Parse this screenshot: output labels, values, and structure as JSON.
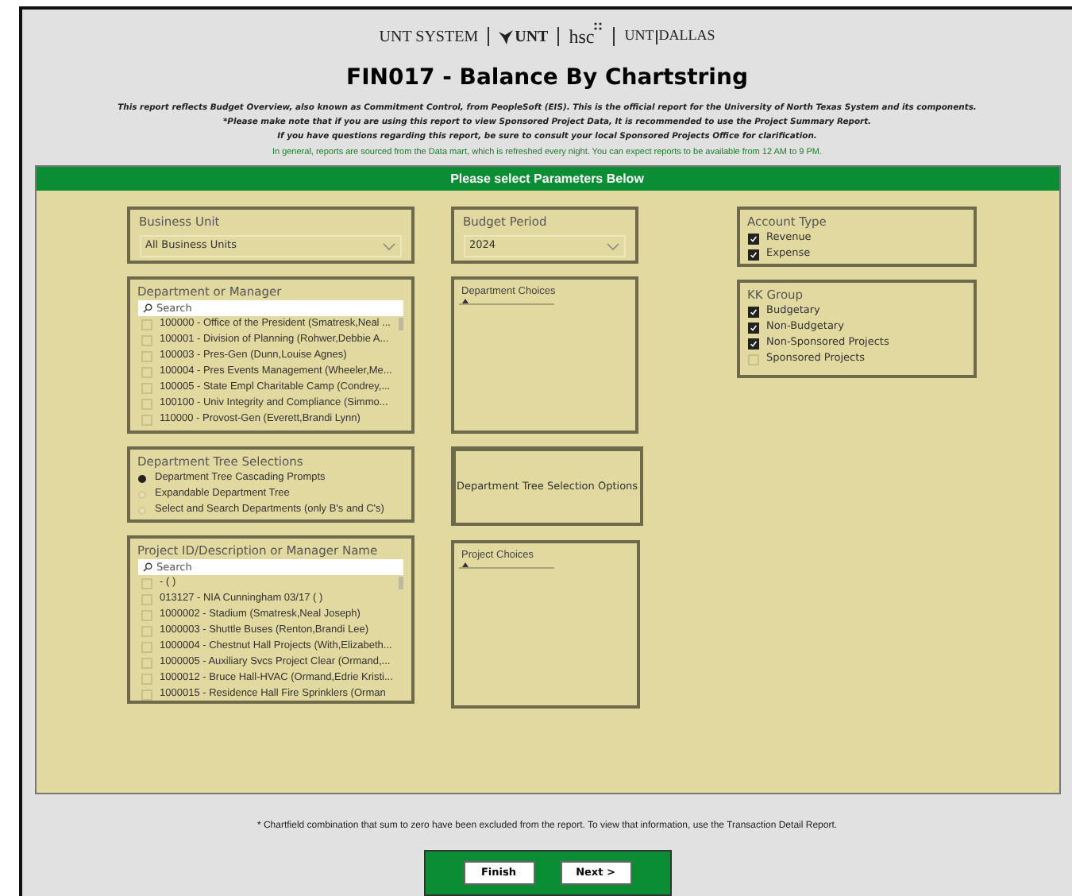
{
  "logos": [
    "UNT SYSTEM",
    "UNT",
    "hsc",
    "UNT",
    "DALLAS"
  ],
  "title": "FIN017 - Balance By Chartstring",
  "notes": [
    "This report reflects Budget Overview, also known as Commitment Control, from PeopleSoft (EIS). This is the official report for the University of North Texas System and its components.",
    "*Please make note that if you are using this report to view Sponsored Project Data, It is recommended to use the Project Summary Report.",
    "If you have questions regarding this report, be sure to consult your local Sponsored Projects Office for clarification."
  ],
  "info": "In general, reports are sourced from the Data mart, which is refreshed every night. You can expect reports to be available from 12 AM to 9 PM.",
  "panel_header": "Please select Parameters Below",
  "business_unit": {
    "label": "Business Unit",
    "value": "All Business Units"
  },
  "budget_period": {
    "label": "Budget Period",
    "value": "2024"
  },
  "account_type": {
    "label": "Account Type",
    "options": [
      {
        "label": "Revenue",
        "checked": true
      },
      {
        "label": "Expense",
        "checked": true
      }
    ]
  },
  "kk_group": {
    "label": "KK Group",
    "options": [
      {
        "label": "Budgetary",
        "checked": true
      },
      {
        "label": "Non-Budgetary",
        "checked": true
      },
      {
        "label": "Non-Sponsored Projects",
        "checked": true
      },
      {
        "label": "Sponsored Projects",
        "checked": false
      }
    ]
  },
  "department": {
    "label": "Department or Manager",
    "placeholder": "Search",
    "items": [
      {
        "label": "100000 - Office of the President (Smatresk,Neal ...",
        "checked": false
      },
      {
        "label": "100001 - Division of Planning (Rohwer,Debbie A...",
        "checked": false
      },
      {
        "label": "100003 - Pres-Gen (Dunn,Louise Agnes)",
        "checked": false
      },
      {
        "label": "100004 - Pres Events Management (Wheeler,Me...",
        "checked": false
      },
      {
        "label": "100005 - State Empl Charitable Camp (Condrey,...",
        "checked": false
      },
      {
        "label": "100100 - Univ Integrity and Compliance (Simmo...",
        "checked": false
      },
      {
        "label": "110000 - Provost-Gen (Everett,Brandi Lynn)",
        "checked": false
      }
    ]
  },
  "department_choices": {
    "label": "Department Choices"
  },
  "tree_selections": {
    "label": "Department Tree Selections",
    "options": [
      {
        "label": "Department Tree Cascading Prompts",
        "selected": true
      },
      {
        "label": "Expandable Department Tree",
        "selected": false
      },
      {
        "label": "Select and Search Departments (only B's and C's)",
        "selected": false
      }
    ]
  },
  "tree_options_button": "Department Tree Selection Options",
  "project": {
    "label": "Project ID/Description or Manager Name",
    "placeholder": "Search",
    "items": [
      {
        "label": "- ( )",
        "checked": false
      },
      {
        "label": "013127 - NIA Cunningham 03/17 ( )",
        "checked": false
      },
      {
        "label": "1000002 - Stadium (Smatresk,Neal Joseph)",
        "checked": false
      },
      {
        "label": "1000003 - Shuttle Buses (Renton,Brandi Lee)",
        "checked": false
      },
      {
        "label": "1000004 - Chestnut Hall Projects (With,Elizabeth...",
        "checked": false
      },
      {
        "label": "1000005 - Auxiliary Svcs Project Clear (Ormand,...",
        "checked": false
      },
      {
        "label": "1000012 - Bruce Hall-HVAC (Ormand,Edrie Kristi...",
        "checked": false
      },
      {
        "label": "1000015 - Residence Hall Fire Sprinklers (Orman",
        "checked": false
      }
    ]
  },
  "project_choices": {
    "label": "Project Choices"
  },
  "footnote": "* Chartfield combination that sum to zero have been excluded from the report. To view that information, use the Transaction Detail Report.",
  "buttons": [
    "Finish",
    "Next >"
  ]
}
